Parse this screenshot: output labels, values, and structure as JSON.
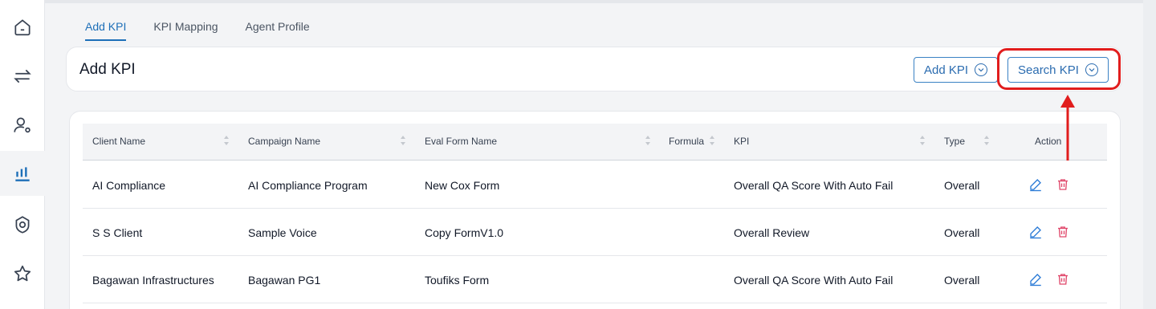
{
  "sidebar": {
    "items": [
      {
        "icon": "home-icon"
      },
      {
        "icon": "transfer-arrows-icon"
      },
      {
        "icon": "user-settings-icon"
      },
      {
        "icon": "bar-chart-icon",
        "active": true
      },
      {
        "icon": "badge-settings-icon"
      },
      {
        "icon": "star-icon"
      }
    ]
  },
  "tabs": [
    {
      "label": "Add KPI",
      "active": true
    },
    {
      "label": "KPI Mapping"
    },
    {
      "label": "Agent Profile"
    }
  ],
  "header": {
    "title": "Add KPI",
    "add_kpi_button": "Add KPI",
    "search_kpi_button": "Search KPI"
  },
  "table": {
    "columns": [
      "Client Name",
      "Campaign Name",
      "Eval Form Name",
      "Formula",
      "KPI",
      "Type",
      "Action"
    ],
    "rows": [
      {
        "client": "AI Compliance",
        "campaign": "AI Compliance Program",
        "form": "New Cox Form",
        "formula": "",
        "kpi": "Overall QA Score With Auto Fail",
        "type": "Overall"
      },
      {
        "client": "S S Client",
        "campaign": "Sample Voice",
        "form": "Copy FormV1.0",
        "formula": "",
        "kpi": "Overall Review",
        "type": "Overall"
      },
      {
        "client": "Bagawan Infrastructures",
        "campaign": "Bagawan PG1",
        "form": "Toufiks Form",
        "formula": "",
        "kpi": "Overall QA Score With Auto Fail",
        "type": "Overall"
      }
    ]
  },
  "colors": {
    "accent": "#1d6fb8",
    "highlight": "#e11d1d",
    "edit": "#2b7bd6",
    "delete": "#e0486b"
  }
}
